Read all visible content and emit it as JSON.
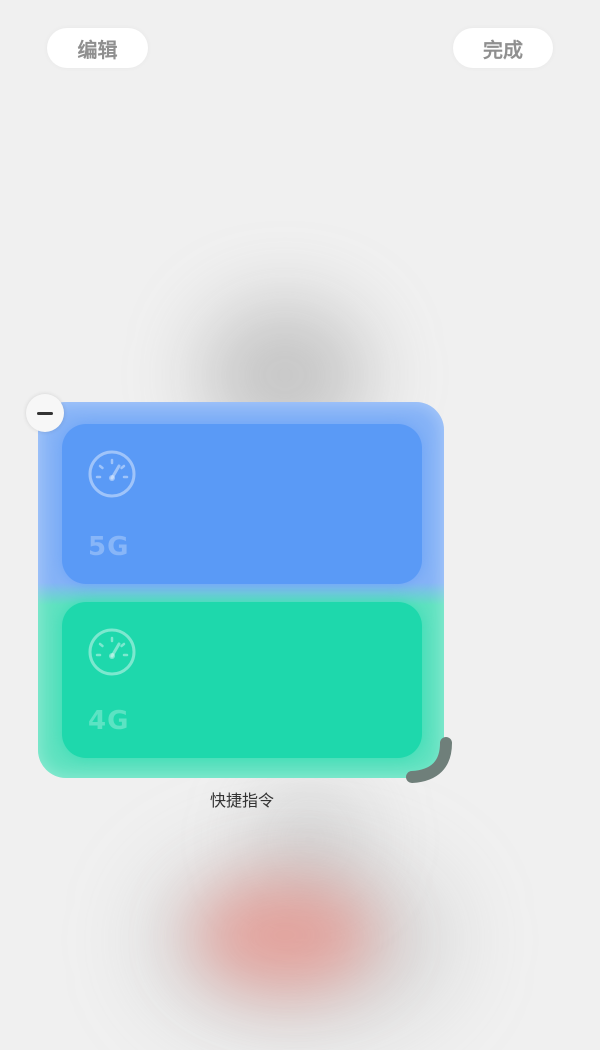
{
  "header": {
    "edit_label": "编辑",
    "done_label": "完成"
  },
  "widget": {
    "caption": "快捷指令",
    "tiles": [
      {
        "label": "5G",
        "icon": "speedometer-icon",
        "color": "#5a9af6"
      },
      {
        "label": "4G",
        "icon": "speedometer-icon",
        "color": "#1ed8ac"
      }
    ]
  },
  "colors": {
    "background": "#f0f0f0",
    "button_text": "#8f8f8f",
    "tile_5g": "#5a9af6",
    "tile_4g": "#1ed8ac"
  }
}
